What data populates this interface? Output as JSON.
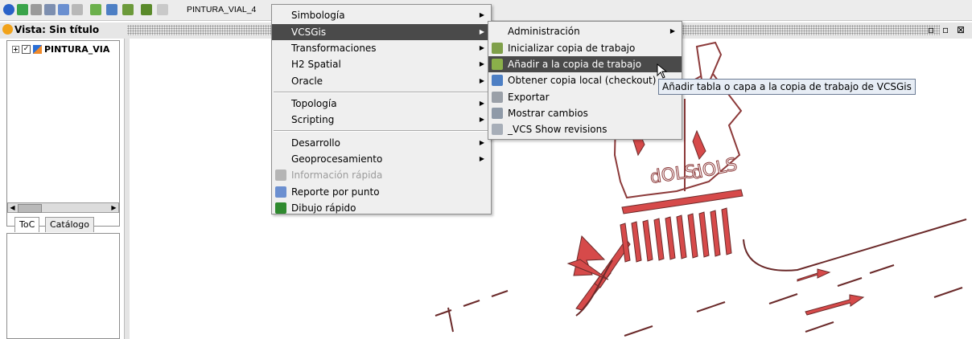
{
  "toolbar": {
    "layer_combo_text": "PINTURA_VIAL_4",
    "icons": [
      "globe-icon",
      "map-icon",
      "layers-icon",
      "print-icon",
      "edit-icon",
      "view-icon",
      "add-layer-icon",
      "vcs-icon",
      "grid-icon",
      "edit-table-icon",
      "table-icon"
    ]
  },
  "view": {
    "title": "Vista: Sin título",
    "window_buttons": "▫ ▫ ⊠"
  },
  "toc": {
    "layer_name": "PINTURA_VIA",
    "tabs": [
      "ToC",
      "Catálogo"
    ]
  },
  "main_menu": {
    "items": [
      {
        "label": "Simbología",
        "submenu": true
      },
      {
        "label": "VCSGis",
        "submenu": true,
        "selected": true
      },
      {
        "label": "Transformaciones",
        "submenu": true
      },
      {
        "label": "H2 Spatial",
        "submenu": true
      },
      {
        "label": "Oracle",
        "submenu": true
      },
      {
        "label": "Topología",
        "submenu": true
      },
      {
        "label": "Scripting",
        "submenu": true
      },
      {
        "label": "Desarrollo",
        "submenu": true
      },
      {
        "label": "Geoprocesamiento",
        "submenu": true
      },
      {
        "label": "Información rápida",
        "disabled": true
      },
      {
        "label": "Reporte por punto"
      },
      {
        "label": "Dibujo rápido"
      }
    ]
  },
  "vcs_menu": {
    "items": [
      {
        "label": "Administración",
        "submenu": true
      },
      {
        "label": "Inicializar copia de trabajo"
      },
      {
        "label": "Añadir a la copia de trabajo",
        "selected": true
      },
      {
        "label": "Obtener copia local (checkout)"
      },
      {
        "label": "Exportar"
      },
      {
        "label": "Mostrar cambios"
      },
      {
        "label": "_VCS Show revisions"
      }
    ]
  },
  "tooltip": "Añadir tabla o capa a la copia de trabajo de VCSGis",
  "colors": {
    "road_marking": "#d64a4a",
    "outline": "#6b2a2a",
    "menu_bg": "#efefef",
    "selected_bg": "#4a4a4a"
  }
}
